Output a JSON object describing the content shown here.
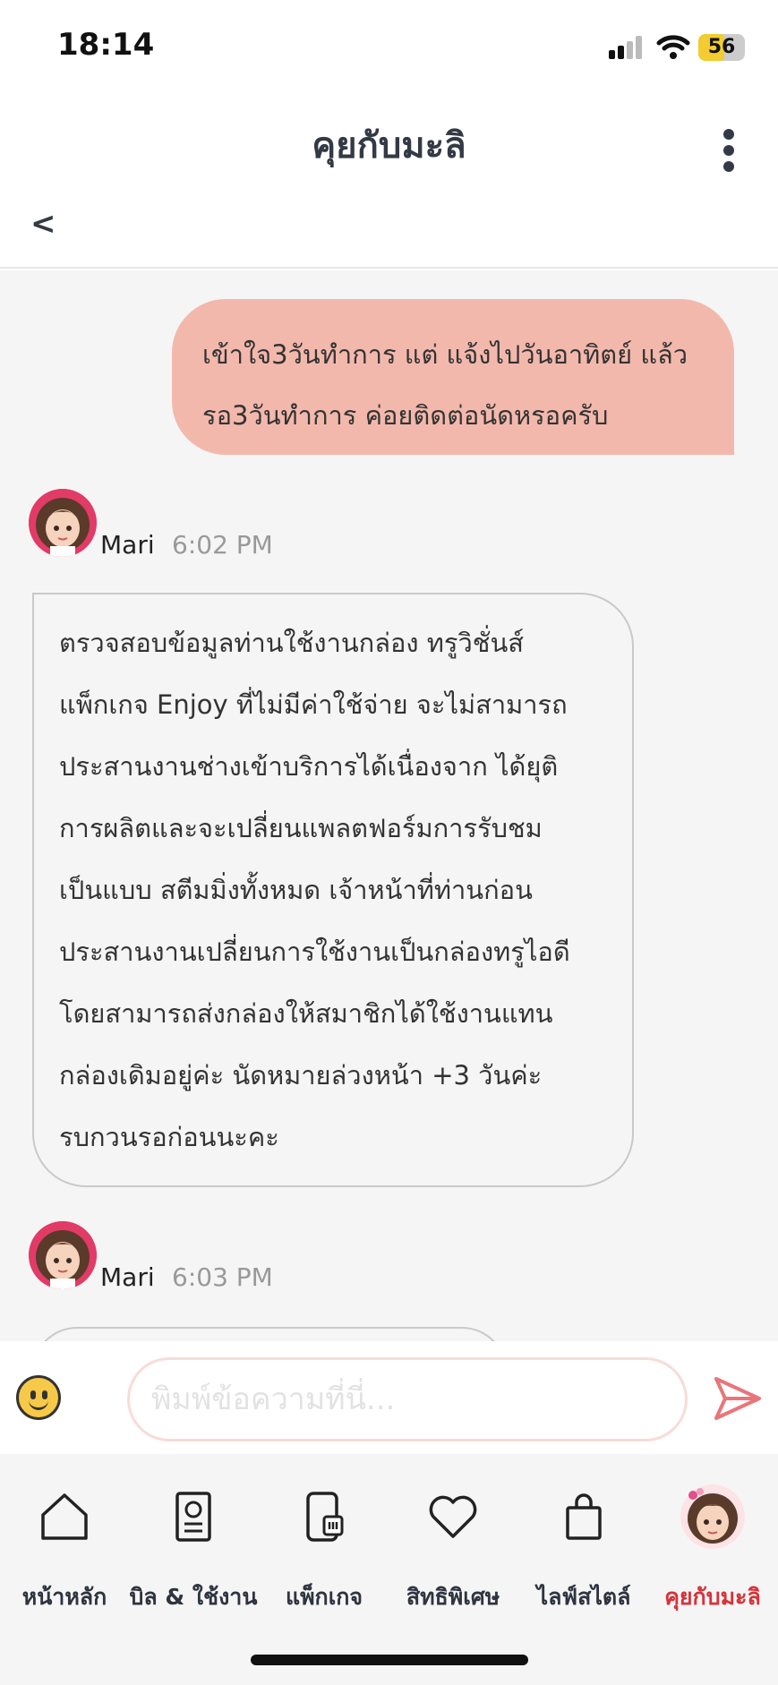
{
  "status_bar": {
    "time": "18:14",
    "battery": "56",
    "battery_level": 0.56
  },
  "header": {
    "title": "คุยกับมะลิ",
    "back_label": "<"
  },
  "messages": [
    {
      "sender": "user",
      "lines": [
        "เข้าใจ3วันทำการ แต่ แจ้งไปวันอาทิตย์ แล้ว",
        "รอ3วันทำการ ค่อยติดต่อนัดหรอครับ"
      ]
    },
    {
      "sender": "Mari",
      "time": "6:02 PM",
      "lines": [
        "ตรวจสอบข้อมูลท่านใช้งานกล่อง ทรูวิชั่นส์",
        "แพ็กเกจ Enjoy ที่ไม่มีค่าใช้จ่าย จะไม่สามารถ",
        "ประสานงานช่างเข้าบริการได้เนื่องจาก ได้ยุติ",
        "การผลิตและจะเปลี่ยนแพลตฟอร์มการรับชม",
        "เป็นแบบ สตีมมิ่งทั้งหมด เจ้าหน้าที่ท่านก่อน",
        "ประสานงานเปลี่ยนการใช้งานเป็นกล่องทรูไอดี",
        "โดยสามารถส่งกล่องให้สมาชิกได้ใช้งานแทน",
        "กล่องเดิมอยู่ค่ะ นัดหมายล่วงหน้า +3 วันค่ะ",
        "รบกวนรอก่อนนะคะ"
      ]
    },
    {
      "sender": "Mari",
      "time": "6:03 PM"
    }
  ],
  "input": {
    "placeholder": "พิมพ์ข้อความที่นี่..."
  },
  "nav": [
    {
      "label": "หน้าหลัก",
      "icon": "home-icon"
    },
    {
      "label": "บิล & ใช้งาน",
      "icon": "bill-icon"
    },
    {
      "label": "แพ็กเกจ",
      "icon": "phone-package-icon"
    },
    {
      "label": "สิทธิพิเศษ",
      "icon": "heart-icon"
    },
    {
      "label": "ไลฟ์สไตล์",
      "icon": "shopping-bag-icon"
    },
    {
      "label": "คุยกับมะลิ",
      "icon": "mari-avatar-icon",
      "active": true
    }
  ],
  "colors": {
    "accent": "#d6323a",
    "user_bubble": "#f3b8ac",
    "avatar_bg": "#e23b66"
  }
}
